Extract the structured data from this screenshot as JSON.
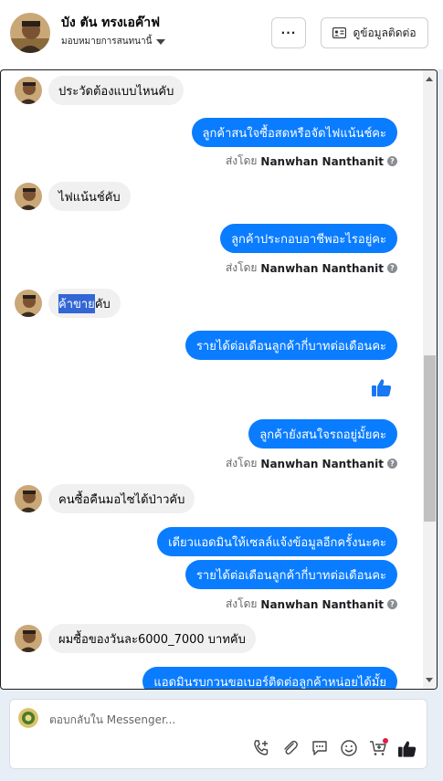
{
  "header": {
    "name": "บัง ตัน ทรงเอค๊าฟ",
    "assign_label": "มอบหมายการสนทนานี้",
    "more_label": "···",
    "contact_label": "ดูข้อมูลติดต่อ"
  },
  "messages": {
    "m1": "ประวัดต้องแบบไหนคับ",
    "m2": "ลูกค้าสนใจซื้อสดหรือจัดไฟแน้นช์คะ",
    "m3": "ไฟแน้นช์คับ",
    "m4": "ลูกค้าประกอบอาชีพอะไรอยู่คะ",
    "m5_highlight": "ค้าขาย",
    "m5_rest": "คับ",
    "m6": "รายได้ต่อเดือนลูกค้ากี่บาทต่อเดือนคะ",
    "m8": "ลูกค้ายังสนใจรถอยู่มั้ยคะ",
    "m9": "คนซื้อคืนมอไซได้ป่าวคับ",
    "m10": "เดียวแอดมินให้เซลล์แจ้งข้อมูลอีกครั้งนะคะ",
    "m11": "รายได้ต่อเดือนลูกค้ากี่บาทต่อเดือนคะ",
    "m12": "ผมซื้อของวันละ6000_7000 บาทคับ",
    "m13": "แอดมินรบกวนขอเบอร์ติดต่อลูกค้าหน่อยได้มั้ย"
  },
  "sent_by": {
    "prefix": "ส่งโดย",
    "agent": "Nanwhan Nanthanit"
  },
  "composer": {
    "placeholder": "ตอบกลับใน Messenger..."
  },
  "colors": {
    "outgoing_bubble": "#0a7cff",
    "incoming_bubble": "#f0f0f0",
    "like_blue": "#1877f2"
  },
  "icons": {
    "toolbar": [
      "phone-plus-icon",
      "attachment-icon",
      "saved-replies-icon",
      "emoji-icon",
      "cart-plus-icon",
      "like-icon"
    ]
  }
}
